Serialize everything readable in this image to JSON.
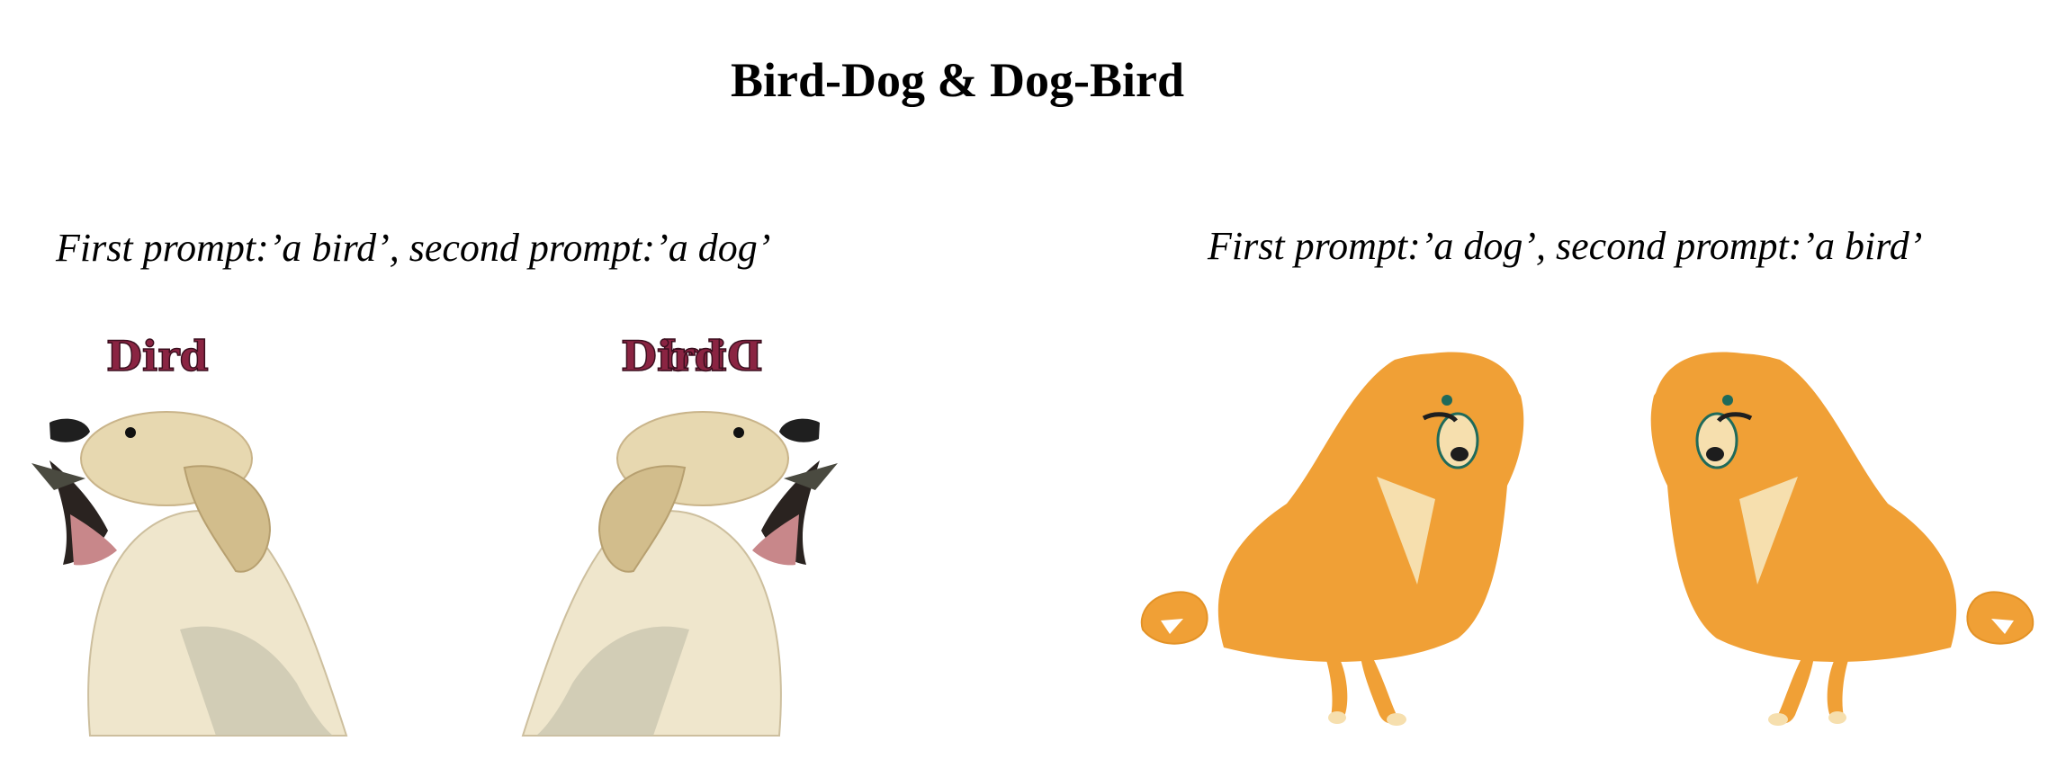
{
  "title": "Bird-Dog & Dog-Bird",
  "left_panel": {
    "caption": "First prompt:’a bird’, second prompt:’a dog’",
    "image_text_left": "Dird",
    "image_text_right": "Dird"
  },
  "right_panel": {
    "caption": "First prompt:’a dog’, second prompt:’a bird’"
  },
  "colors": {
    "orange": "#f0a036",
    "cream": "#f6dfae",
    "puppy_fur": "#efe6cc",
    "puppy_ear": "#d2bd8c",
    "lettering": "#8a2442"
  }
}
